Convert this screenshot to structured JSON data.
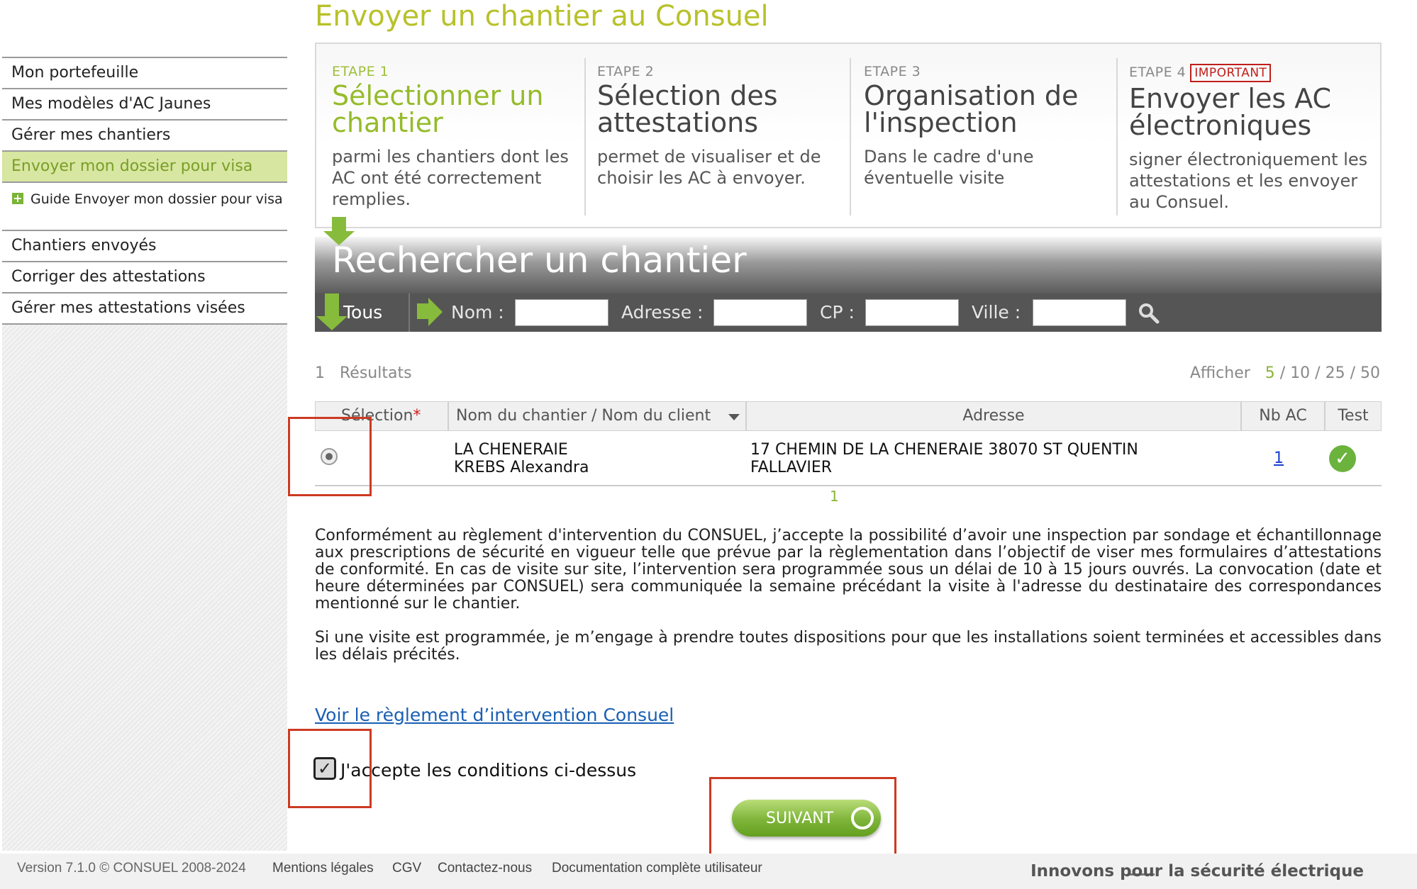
{
  "page_title": "Envoyer un chantier au Consuel",
  "sidebar": {
    "items": [
      {
        "label": "Mon portefeuille"
      },
      {
        "label": "Mes modèles d'AC Jaunes"
      },
      {
        "label": "Gérer mes chantiers"
      },
      {
        "label": "Envoyer mon dossier pour visa"
      },
      {
        "label": "Guide Envoyer mon dossier pour visa"
      },
      {
        "label": "Chantiers envoyés"
      },
      {
        "label": "Corriger des attestations"
      },
      {
        "label": "Gérer mes attestations visées"
      }
    ]
  },
  "steps": [
    {
      "num": "ETAPE 1",
      "title": "Sélectionner un chantier",
      "desc": "parmi les chantiers dont les AC ont été correctement remplies."
    },
    {
      "num": "ETAPE 2",
      "title": "Sélection des attestations",
      "desc": "permet de visualiser et de choisir les AC à envoyer."
    },
    {
      "num": "ETAPE 3",
      "title": "Organisation de l'inspection",
      "desc": "Dans le cadre d'une éventuelle visite"
    },
    {
      "num": "ETAPE 4",
      "badge": "IMPORTANT",
      "title": "Envoyer les AC électroniques",
      "desc": "signer électroniquement les attestations et les envoyer au Consuel."
    }
  ],
  "search": {
    "title": "Rechercher un chantier",
    "all_label": "Tous",
    "nom_label": "Nom :",
    "adresse_label": "Adresse :",
    "cp_label": "CP :",
    "ville_label": "Ville :"
  },
  "results": {
    "count": "1",
    "label": "Résultats",
    "show_label": "Afficher",
    "page_sizes": [
      "5",
      "10",
      "25",
      "50"
    ],
    "current_size": "5",
    "page": "1"
  },
  "table": {
    "headers": {
      "selection": "Sélection",
      "required_mark": "*",
      "name": "Nom du chantier / Nom du client",
      "address": "Adresse",
      "nb_ac": "Nb AC",
      "test": "Test"
    },
    "rows": [
      {
        "site": "LA CHENERAIE",
        "client": "KREBS Alexandra",
        "address_line1": "17 CHEMIN DE LA CHENERAIE 38070 ST QUENTIN",
        "address_line2": "FALLAVIER",
        "nb_ac": "1"
      }
    ]
  },
  "terms": {
    "p1": "Conformément au règlement d'intervention du CONSUEL, j’accepte la possibilité d’avoir une inspection par sondage et échantillonnage aux prescriptions de sécurité en vigueur telle que prévue par la règlementation dans l’objectif de viser mes formulaires d’attestations de conformité. En cas de visite sur site, l’intervention sera programmée sous un délai de 10 à 15 jours ouvrés. La convocation (date et heure déterminées par CONSUEL) sera communiquée la semaine précédant la visite à l'adresse du destinataire des correspondances mentionné sur le chantier.",
    "p2": "Si une visite est programmée, je m’engage à prendre toutes dispositions pour que les installations soient terminées et accessibles dans les délais précités.",
    "link": "Voir le règlement d’intervention Consuel",
    "accept": "J'accepte les conditions ci-dessus"
  },
  "next_button": "SUIVANT",
  "footer": {
    "version": "Version 7.1.0 © CONSUEL 2008-2024",
    "links": [
      "Mentions légales",
      "CGV",
      "Contactez-nous",
      "Documentation complète utilisateur"
    ],
    "tagline": "Innovons pour la sécurité électrique"
  },
  "colors": {
    "accent_green": "#8ab33a",
    "title_yellow_green": "#b8c12a",
    "highlight_red": "#cc3a22"
  }
}
